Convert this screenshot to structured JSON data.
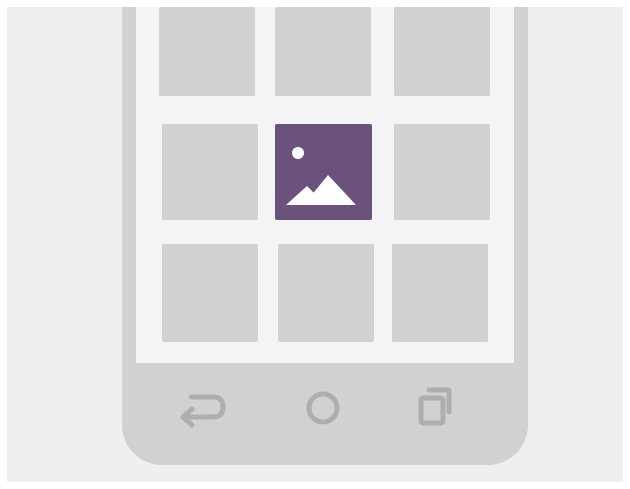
{
  "device": {
    "type": "android-phone",
    "screen": {
      "grid": {
        "rows": 3,
        "columns": 3,
        "selected_tile": {
          "row": 2,
          "column": 2,
          "icon": "image-icon"
        }
      }
    },
    "navigation_bar": {
      "buttons": [
        {
          "name": "back",
          "icon": "back-arrow-icon"
        },
        {
          "name": "home",
          "icon": "home-circle-icon"
        },
        {
          "name": "recents",
          "icon": "recent-apps-icon"
        }
      ]
    }
  },
  "colors": {
    "background": "#efeff0",
    "device_body": "#d1d1d3",
    "screen": "#f4f4f6",
    "tile": "#d1d1d3",
    "selected_tile": "#6b527c",
    "icon_foreground": "#ffffff",
    "nav_icon": "#aeaeb1"
  }
}
